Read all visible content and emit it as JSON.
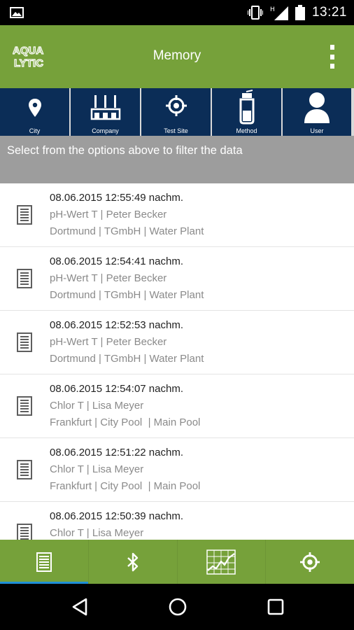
{
  "status_bar": {
    "time": "13:21",
    "icons": [
      "image-icon",
      "vibrate-icon",
      "signal-icon",
      "battery-icon"
    ]
  },
  "app_bar": {
    "logo_text": "AQUALYTIC",
    "title": "Memory",
    "overflow_icon": "more-vert-icon"
  },
  "filters": [
    {
      "label": "City",
      "icon": "location-pin-icon"
    },
    {
      "label": "Company",
      "icon": "factory-icon"
    },
    {
      "label": "Test Site",
      "icon": "crosshair-icon"
    },
    {
      "label": "Method",
      "icon": "bottle-icon"
    },
    {
      "label": "User",
      "icon": "user-icon"
    }
  ],
  "hint": "Select from the options above to filter the data",
  "records": [
    {
      "datetime": "08.06.2015 12:55:49 nachm.",
      "method_user": "pH-Wert T | Peter Becker",
      "location": "Dortmund | TGmbH | Water Plant"
    },
    {
      "datetime": "08.06.2015 12:54:41 nachm.",
      "method_user": "pH-Wert T | Peter Becker",
      "location": "Dortmund | TGmbH | Water Plant"
    },
    {
      "datetime": "08.06.2015 12:52:53 nachm.",
      "method_user": "pH-Wert T | Peter Becker",
      "location": "Dortmund | TGmbH | Water Plant"
    },
    {
      "datetime": "08.06.2015 12:54:07 nachm.",
      "method_user": "Chlor T | Lisa Meyer",
      "location": "Frankfurt | City Pool  | Main Pool"
    },
    {
      "datetime": "08.06.2015 12:51:22 nachm.",
      "method_user": "Chlor T | Lisa Meyer",
      "location": "Frankfurt | City Pool  | Main Pool"
    },
    {
      "datetime": "08.06.2015 12:50:39 nachm.",
      "method_user": "Chlor T | Lisa Meyer",
      "location": ""
    }
  ],
  "bottom_nav": [
    {
      "icon": "memory-list-icon",
      "active": true
    },
    {
      "icon": "bluetooth-icon",
      "active": false
    },
    {
      "icon": "chart-icon",
      "active": false
    },
    {
      "icon": "crosshair-icon",
      "active": false
    }
  ],
  "system_nav": [
    "back-icon",
    "home-icon",
    "recents-icon"
  ],
  "colors": {
    "primary_green": "#76a13a",
    "filter_navy": "#0b2d57",
    "hint_gray": "#9d9d9d",
    "active_indicator": "#1f8fd6"
  }
}
